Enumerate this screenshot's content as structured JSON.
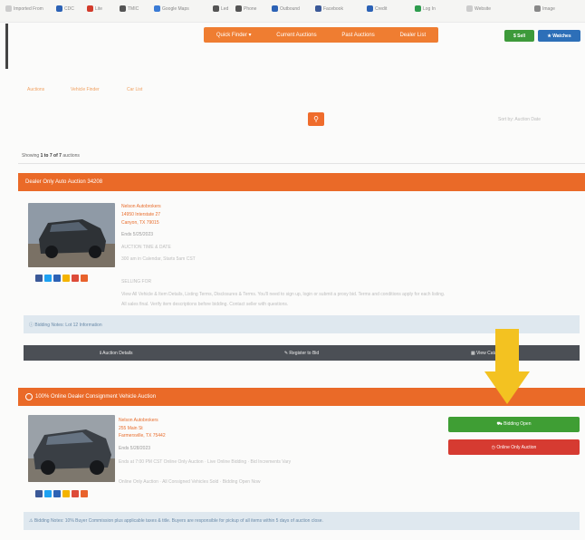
{
  "bookmarks": [
    {
      "label": "Imported From",
      "color": "#cccccc"
    },
    {
      "label": "CDC",
      "color": "#2c62b5"
    },
    {
      "label": "Lite",
      "color": "#d23b2b"
    },
    {
      "label": "TMIC",
      "color": "#555555"
    },
    {
      "label": "Google Maps",
      "color": "#3a7bd5"
    },
    {
      "label": "Led",
      "color": "#555555"
    },
    {
      "label": "Phone",
      "color": "#555555"
    },
    {
      "label": "Outbound",
      "color": "#2c62b5"
    },
    {
      "label": "Facebook",
      "color": "#3b5998"
    },
    {
      "label": "Credit",
      "color": "#2c62b5"
    },
    {
      "label": "Log In",
      "color": "#2e9c4e"
    },
    {
      "label": "Website",
      "color": "#cccccc"
    },
    {
      "label": "Image",
      "color": "#888888"
    }
  ],
  "nav": {
    "items": [
      "Quick Finder ▾",
      "Current Auctions",
      "Past Auctions",
      "Dealer List"
    ]
  },
  "header_buttons": {
    "sell": "$ Sell",
    "watches": "★ Watches"
  },
  "breadcrumbs": [
    "Auctions",
    "Vehicle Finder",
    "Car List"
  ],
  "search_icon": "⚲",
  "faint_right": "Sort by: Auction Date",
  "showing": {
    "prefix": "Showing",
    "range": "1 to 7 of 7",
    "suffix": "auctions"
  },
  "auction1": {
    "title": "Dealer Only Auto Auction 34208",
    "lines": [
      "Nelson Autobrokers",
      "14950 Interstate 27",
      "Canyon, TX 79015",
      "Ends 5/25/2023",
      "AUCTION TIME & DATE",
      "300 am in Calendar, Starts 5am CST"
    ],
    "seller_label": "SELLING FOR",
    "desc1": "View All Vehicle & Item Details, Listing Terms, Disclosures & Terms. You'll need to sign up, login or submit a proxy bid. Terms and conditions apply for each listing.",
    "desc2": "All sales final. Verify item descriptions before bidding. Contact seller with questions.",
    "info": "ⓘ Bidding Notes: Lot 12 Information",
    "bar": [
      "ℹ Auction Details",
      "✎ Register to Bid",
      "▦ View Catalog"
    ]
  },
  "auction2": {
    "title": "100% Online Dealer Consignment Vehicle Auction",
    "lines": [
      "Nelson Autobrokers",
      "255 Main St",
      "Farmersville, TX 75442",
      "Ends 5/28/2023"
    ],
    "detail1": "Ends at 7:00 PM CST Online Only Auction · Live Online Bidding · Bid Increments Vary",
    "detail2": "Online Only Auction · All Consigned Vehicles Sold · Bidding Open Now",
    "btn_open": "⛟ Bidding Open",
    "btn_online": "◷ Online Only Auction",
    "info": "⚠ Bidding Notes: 10% Buyer Commission plus applicable taxes & title. Buyers are responsible for pickup of all items within 5 days of auction close."
  },
  "share_colors": [
    "#3b5998",
    "#1da1f2",
    "#2c62b5",
    "#f4b400",
    "#dd4b39",
    "#e8622c"
  ],
  "colors": {
    "accent": "#ef7d31",
    "header": "#ea6a28",
    "green": "#3f9e34",
    "red": "#d63b31",
    "arrow": "#f3c221"
  }
}
